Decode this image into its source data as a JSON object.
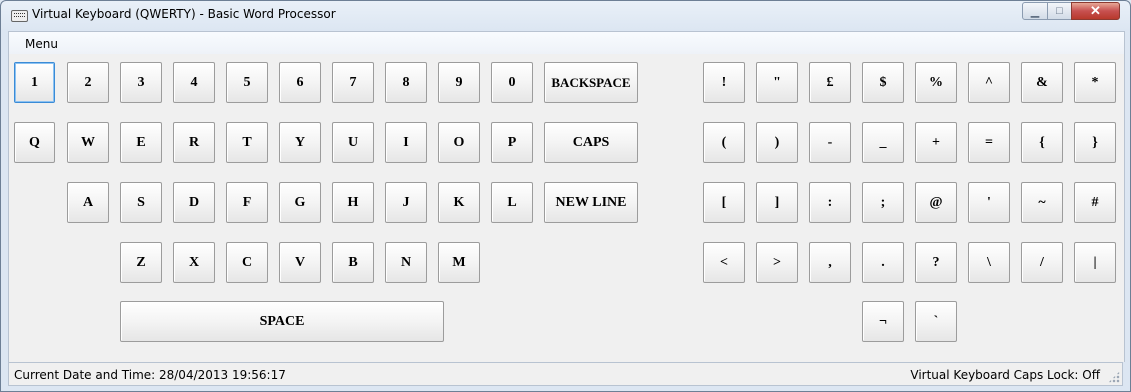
{
  "window": {
    "title": "Virtual Keyboard (QWERTY) - Basic Word Processor",
    "close_glyph": "✕",
    "minimize_glyph": "▁",
    "maximize_glyph": "□"
  },
  "menu": {
    "label": "Menu"
  },
  "keys": {
    "k1": "1",
    "k2": "2",
    "k3": "3",
    "k4": "4",
    "k5": "5",
    "k6": "6",
    "k7": "7",
    "k8": "8",
    "k9": "9",
    "k0": "0",
    "backspace": "BACKSPACE",
    "q": "Q",
    "w": "W",
    "e": "E",
    "r": "R",
    "t": "T",
    "y": "Y",
    "u": "U",
    "i": "I",
    "o": "O",
    "p": "P",
    "caps": "CAPS",
    "a": "A",
    "s": "S",
    "d": "D",
    "f": "F",
    "g": "G",
    "h": "H",
    "j": "J",
    "k": "K",
    "l": "L",
    "newline": "NEW LINE",
    "z": "Z",
    "x": "X",
    "c": "C",
    "v": "V",
    "b": "B",
    "n": "N",
    "m": "M",
    "space": "SPACE"
  },
  "symbols": {
    "exclaim": "!",
    "dquote": "\"",
    "pound": "£",
    "dollar": "$",
    "percent": "%",
    "caret": "^",
    "amp": "&",
    "star": "*",
    "lparen": "(",
    "rparen": ")",
    "minus": "-",
    "underscore": "_",
    "plus": "+",
    "equals": "=",
    "lbrace": "{",
    "rbrace": "}",
    "lbracket": "[",
    "rbracket": "]",
    "colon": ":",
    "semicolon": ";",
    "at": "@",
    "squote": "'",
    "tilde": "~",
    "hash": "#",
    "lt": "<",
    "gt": ">",
    "comma": ",",
    "period": ".",
    "question": "?",
    "backslash": "\\",
    "slash": "/",
    "pipe": "|",
    "not": "¬",
    "backtick": "`"
  },
  "status": {
    "datetime_label": "Current Date and Time:  28/04/2013 19:56:17",
    "caps_lock": "Virtual Keyboard Caps Lock: Off"
  }
}
